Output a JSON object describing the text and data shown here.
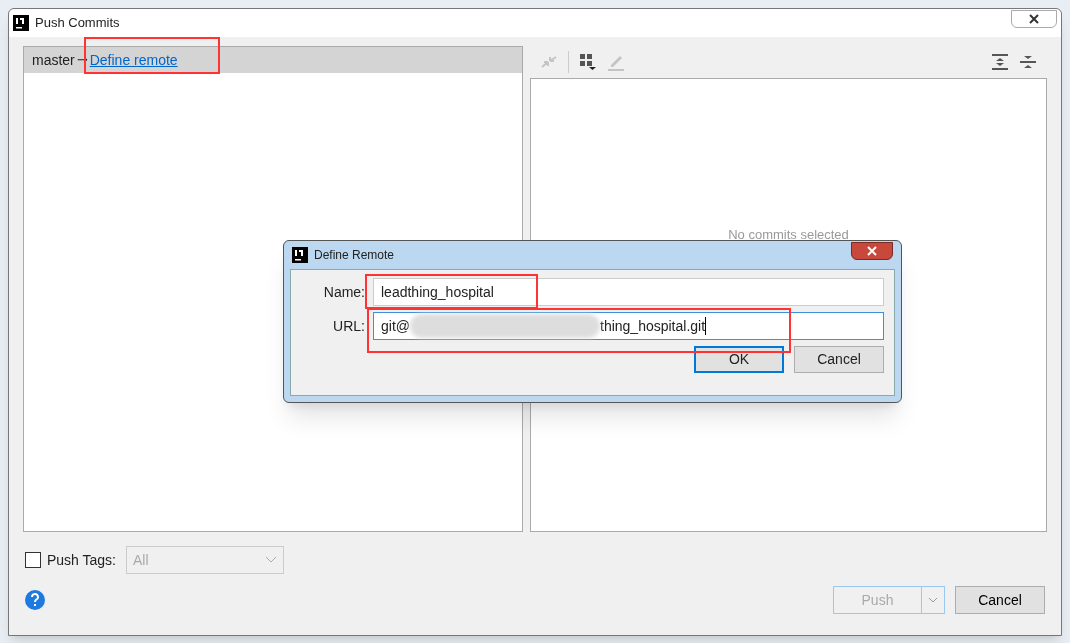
{
  "window": {
    "title": "Push Commits"
  },
  "branch_row": {
    "branch": "master",
    "arrow": "→",
    "link": "Define remote",
    "selected": true
  },
  "details": {
    "empty_text": "No commits selected"
  },
  "push_tags": {
    "label": "Push Tags:",
    "checked": false,
    "value": "All"
  },
  "buttons": [
    {
      "label": "Push",
      "kind": "split",
      "disabled": true
    },
    {
      "label": "Cancel",
      "kind": "plain",
      "disabled": false
    }
  ],
  "dialog": {
    "title": "Define Remote",
    "fields": [
      {
        "label": "Name:",
        "value": "leadthing_hospital",
        "focused": false
      },
      {
        "label": "URL:",
        "value_prefix": "git@",
        "value_suffix": "thing_hospital.git",
        "redacted": true,
        "focused": true
      }
    ],
    "buttons": [
      {
        "label": "OK",
        "default": true
      },
      {
        "label": "Cancel",
        "default": false
      }
    ]
  }
}
